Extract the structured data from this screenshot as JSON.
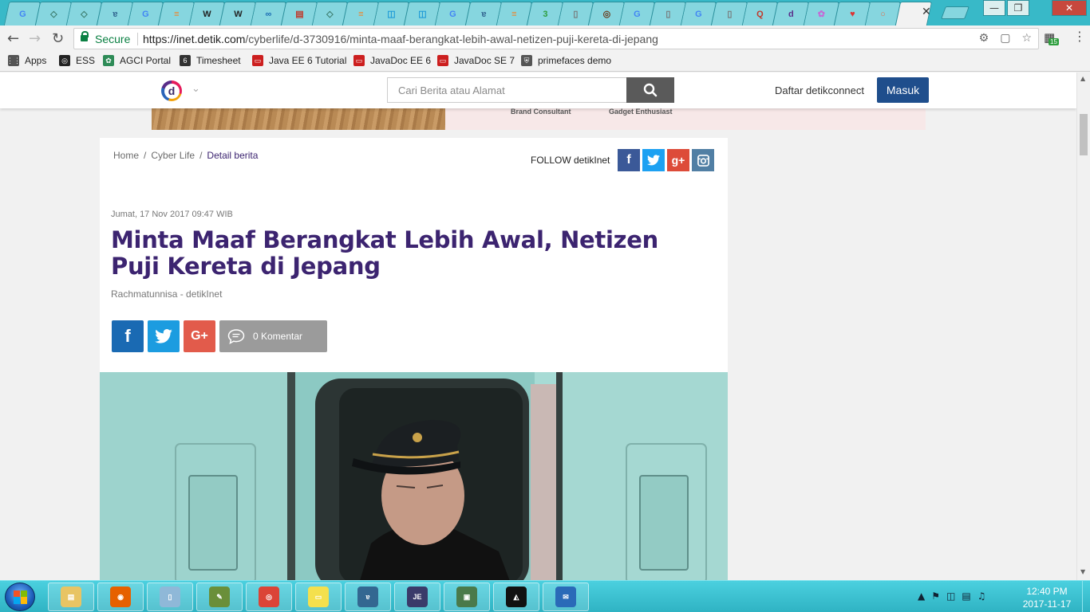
{
  "browser": {
    "tab_favicons": [
      "google",
      "dia",
      "dia",
      "elephant",
      "google",
      "stack",
      "wiki",
      "wiki",
      "oo",
      "server",
      "dia",
      "stack",
      "db",
      "db",
      "google",
      "elephant",
      "stack",
      "ab",
      "doc",
      "bear",
      "google",
      "doc",
      "google",
      "doc",
      "q",
      "detik",
      "flower",
      "heart",
      "ring",
      "blank"
    ],
    "active_tab_close": "✕",
    "window_controls": {
      "minimize": "—",
      "maximize": "❐",
      "close": "✕"
    },
    "secure_label": "Secure",
    "url_host": "https://inet.detik.com",
    "url_path": "/cyberlife/d-3730916/minta-maaf-berangkat-lebih-awal-netizen-puji-kereta-di-jepang",
    "extension_badge": "15",
    "bookmarks": [
      {
        "label": "Apps",
        "icon": "apps-grid",
        "color": "#555555"
      },
      {
        "label": "ESS",
        "icon": "ring",
        "color": "#222222"
      },
      {
        "label": "AGCI Portal",
        "icon": "leaf",
        "color": "#2e8b57"
      },
      {
        "label": "Timesheet",
        "icon": "eap",
        "color": "#333333"
      },
      {
        "label": "Java EE 6 Tutorial",
        "icon": "oracle",
        "color": "#cc1f1f"
      },
      {
        "label": "JavaDoc EE 6",
        "icon": "oracle",
        "color": "#cc1f1f"
      },
      {
        "label": "JavaDoc SE 7",
        "icon": "oracle",
        "color": "#cc1f1f"
      },
      {
        "label": "primefaces demo",
        "icon": "shield",
        "color": "#555555"
      }
    ]
  },
  "site": {
    "logo_letter": "d",
    "search_placeholder": "Cari Berita atau Alamat",
    "register_label": "Daftar detikconnect",
    "login_label": "Masuk",
    "ad_text_1": "Brand Consultant",
    "ad_text_2": "Gadget Enthusiast"
  },
  "article": {
    "breadcrumbs": [
      {
        "label": "Home"
      },
      {
        "label": "Cyber Life"
      },
      {
        "label": "Detail berita"
      }
    ],
    "breadcrumb_separator": "/",
    "follow_label": "FOLLOW detikInet",
    "follow_buttons": [
      {
        "icon": "facebook-icon",
        "glyph": "f",
        "color": "#3b5998"
      },
      {
        "icon": "twitter-icon",
        "glyph": "t",
        "color": "#1da1f2"
      },
      {
        "icon": "google-plus-icon",
        "glyph": "g+",
        "color": "#dd4b39"
      },
      {
        "icon": "instagram-icon",
        "glyph": "ig",
        "color": "#517fa4"
      }
    ],
    "date": "Jumat, 17 Nov 2017 09:47 WIB",
    "title": "Minta Maaf Berangkat Lebih Awal, Netizen Puji Kereta di Jepang",
    "author": "Rachmatunnisa - detikInet",
    "share_colors": {
      "facebook": "#1a6ab3",
      "twitter": "#1c9ce0",
      "google": "#e25b4b"
    },
    "comments_label": "0 Komentar"
  },
  "taskbar": {
    "apps": [
      {
        "icon": "explorer-icon",
        "color": "#e8c463"
      },
      {
        "icon": "firefox-icon",
        "color": "#e66000"
      },
      {
        "icon": "notepad-icon",
        "color": "#8fb8d8"
      },
      {
        "icon": "editor-icon",
        "color": "#6a8f3a"
      },
      {
        "icon": "chrome-icon",
        "color": "#db4437"
      },
      {
        "icon": "sticky-notes-icon",
        "color": "#f4e04d"
      },
      {
        "icon": "pgadmin-icon",
        "color": "#336791"
      },
      {
        "icon": "java-ee-ide-icon",
        "color": "#3a3a6a"
      },
      {
        "icon": "monitor-icon",
        "color": "#4a7a4a"
      },
      {
        "icon": "inkscape-icon",
        "color": "#111111"
      },
      {
        "icon": "thunderbird-icon",
        "color": "#2a6ab8"
      }
    ],
    "time": "12:40 PM",
    "date": "2017-11-17"
  }
}
